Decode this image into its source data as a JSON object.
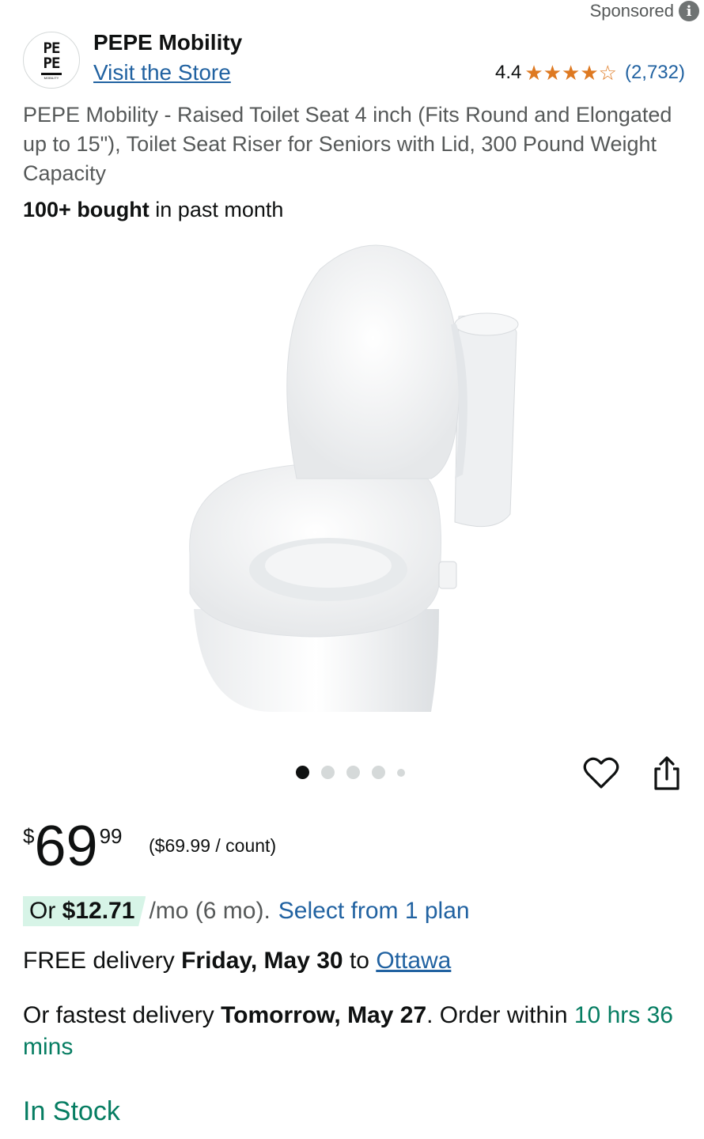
{
  "sponsored": {
    "label": "Sponsored",
    "info_icon": "info-icon"
  },
  "brand": {
    "logo_text_top": "PE",
    "logo_text_bottom": "PE",
    "logo_small": "MOBILITY",
    "name": "PEPE Mobility",
    "visit_store": "Visit the Store"
  },
  "rating": {
    "value": "4.4",
    "stars": 4.4,
    "count": "(2,732)",
    "star_color": "#de7921"
  },
  "product": {
    "title": "PEPE Mobility - Raised Toilet Seat 4 inch (Fits Round and Elongated up to 15\"), Toilet Seat Riser for Seniors with Lid, 300 Pound Weight Capacity",
    "bought_bold": "100+ bought",
    "bought_rest": " in past month",
    "image_icon": "raised-toilet-seat-image"
  },
  "carousel": {
    "total": 5,
    "active_index": 0
  },
  "actions": {
    "heart_icon": "heart-icon",
    "share_icon": "share-icon"
  },
  "price": {
    "symbol": "$",
    "whole": "69",
    "fraction": "99",
    "unit_price": "($69.99 / count)"
  },
  "installment": {
    "prefix": "Or ",
    "amount": "$12.71",
    "rest": " /mo (6 mo).",
    "select_plan": "Select from 1 plan",
    "badge_color": "#d7f4e7"
  },
  "delivery": {
    "free_prefix": "FREE delivery ",
    "free_date": "Friday, May 30",
    "free_to": " to ",
    "location": "Ottawa",
    "fast_prefix": "Or fastest delivery ",
    "fast_date": "Tomorrow, May 27",
    "fast_mid": ". Order within ",
    "countdown": "10 hrs 36 mins"
  },
  "stock": {
    "status": "In Stock",
    "color": "#067d62"
  },
  "colors": {
    "link": "#2162a1",
    "text": "#0f1111",
    "muted": "#565959"
  }
}
